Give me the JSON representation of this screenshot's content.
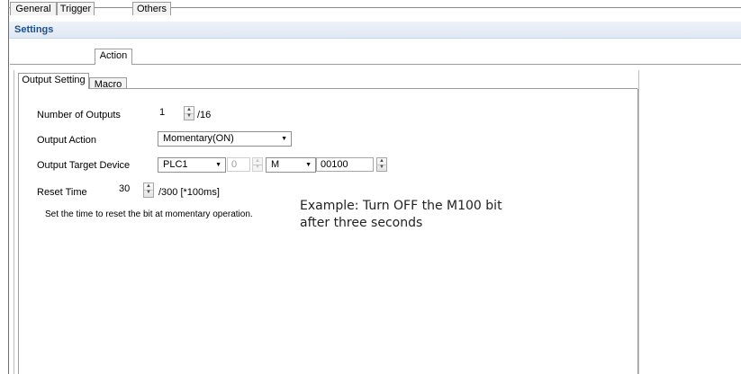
{
  "window": {
    "title": "Settings"
  },
  "tabs": [
    "General",
    "Trigger",
    "Action",
    "Others"
  ],
  "inner_tabs": [
    "Output Setting",
    "Macro"
  ],
  "form": {
    "number_of_outputs": {
      "label": "Number of Outputs",
      "value": "1",
      "suffix": "/16"
    },
    "output_action": {
      "label": "Output Action",
      "selected": "Momentary(ON)"
    },
    "output_target_device": {
      "label": "Output Target Device",
      "plc": "PLC1",
      "station": "0",
      "device_type": "M",
      "address": "00100"
    },
    "reset_time": {
      "label": "Reset Time",
      "value": "30",
      "suffix": "/300 [*100ms]"
    },
    "description": "Set the time to reset the bit at momentary operation."
  },
  "annotation": {
    "line1": "Example: Turn OFF the M100 bit",
    "line2": "after three seconds"
  },
  "icons": {
    "spin_up": "spin-up-arrow-icon",
    "spin_down": "spin-down-arrow-icon",
    "dropdown": "dropdown-arrow-icon"
  }
}
